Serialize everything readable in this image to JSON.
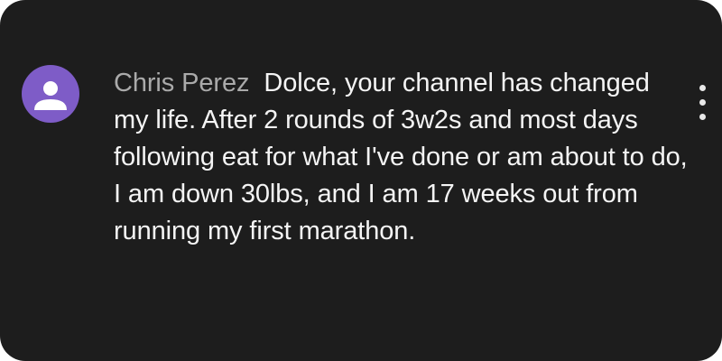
{
  "comment": {
    "author": "Chris Perez",
    "text": "Dolce, your channel has changed my life. After 2 rounds of 3w2s and most days following eat for what I've done or am about to do, I am down 30lbs, and I am 17 weeks out from running my first marathon.",
    "avatar_icon": "default-user-icon",
    "menu_icon": "more-vertical-icon"
  },
  "colors": {
    "background": "#1d1d1d",
    "avatar": "#7e5cc7",
    "author": "#aaaaaa",
    "text": "#f4f4f4"
  }
}
